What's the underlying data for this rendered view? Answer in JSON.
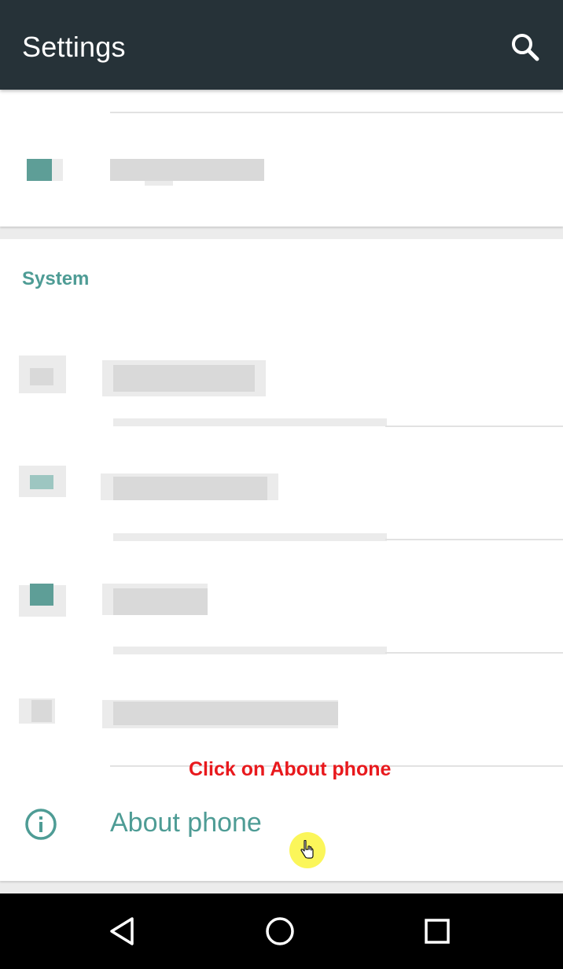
{
  "appbar": {
    "title": "Settings",
    "search_icon": "search-icon",
    "background": "#263238"
  },
  "system_section": {
    "header": "System",
    "accent": "#4e9c95"
  },
  "about_row": {
    "label": "About phone",
    "icon": "info-icon"
  },
  "annotation": {
    "text": "Click on About phone",
    "color": "#e8191d"
  },
  "navbar": {
    "back_icon": "back-triangle-icon",
    "home_icon": "home-circle-icon",
    "recents_icon": "recents-square-icon"
  }
}
